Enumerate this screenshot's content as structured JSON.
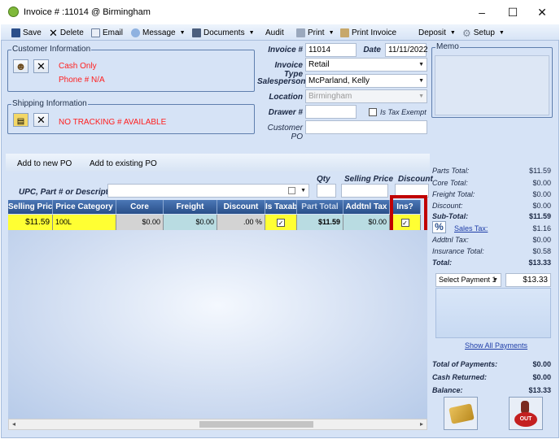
{
  "window": {
    "title": "Invoice # :11014 @ Birmingham",
    "minimize": "–",
    "maximize": "☐",
    "close": "✕"
  },
  "toolbar": {
    "save": "Save",
    "delete": "Delete",
    "email": "Email",
    "message": "Message",
    "documents": "Documents",
    "audit": "Audit",
    "print": "Print",
    "print_invoice": "Print Invoice",
    "deposit": "Deposit",
    "setup": "Setup"
  },
  "customer": {
    "legend": "Customer Information",
    "name": "Cash Only",
    "phone": "Phone # N/A"
  },
  "shipping": {
    "legend": "Shipping Information",
    "tracking": "NO TRACKING # AVAILABLE"
  },
  "invoice": {
    "invoice_label": "Invoice #",
    "invoice_value": "11014",
    "date_label": "Date",
    "date_value": "11/11/2022",
    "type_label": "Invoice Type",
    "type_value": "Retail",
    "salesperson_label": "Salesperson",
    "salesperson_value": "McParland, Kelly",
    "location_label": "Location",
    "location_value": "Birmingham",
    "drawer_label": "Drawer #",
    "drawer_value": "",
    "tax_exempt_label": "Is Tax Exempt",
    "customer_po_label": "Customer PO",
    "customer_po_value": ""
  },
  "memo": {
    "label": "Memo",
    "value": ""
  },
  "tabs": {
    "add_new": "Add to new PO",
    "add_existing": "Add to existing PO"
  },
  "search": {
    "upc_label": "UPC, Part # or Description",
    "qty_label": "Qty",
    "selling_label": "Selling Price",
    "discount_label": "Discount"
  },
  "grid": {
    "headers": [
      "Selling Price",
      "Price Category",
      "Core",
      "Freight",
      "Discount",
      "Is Taxab",
      "Part Total",
      "Addtnl Tax",
      "Ins?"
    ],
    "row": {
      "selling_price": "$11.59",
      "price_category": "100L",
      "core": "$0.00",
      "freight": "$0.00",
      "discount": ".00 %",
      "is_taxable": "✓",
      "part_total": "$11.59",
      "addtnl_tax": "$0.00",
      "ins": "✓"
    }
  },
  "totals": {
    "parts_total_label": "Parts Total:",
    "parts_total": "$11.59",
    "core_total_label": "Core Total:",
    "core_total": "$0.00",
    "freight_total_label": "Freight Total:",
    "freight_total": "$0.00",
    "discount_label": "Discount:",
    "discount": "$0.00",
    "subtotal_label": "Sub-Total:",
    "subtotal": "$11.59",
    "sales_tax_label": "Sales Tax:",
    "sales_tax": "$1.16",
    "addtnl_tax_label": "Addtnl Tax:",
    "addtnl_tax": "$0.00",
    "insurance_total_label": "Insurance Total:",
    "insurance_total": "$0.58",
    "total_label": "Total:",
    "total": "$13.33"
  },
  "payment": {
    "select_label": "Select Payment 1",
    "amount": "$13.33",
    "show_all": "Show All Payments"
  },
  "summary": {
    "total_payments_label": "Total of Payments:",
    "total_payments": "$0.00",
    "cash_returned_label": "Cash Returned:",
    "cash_returned": "$0.00",
    "balance_label": "Balance:",
    "balance": "$13.33"
  },
  "colors": {
    "highlight": "#c00000",
    "yellow_cell": "#ffff33",
    "header_blue": "#315c9b"
  }
}
